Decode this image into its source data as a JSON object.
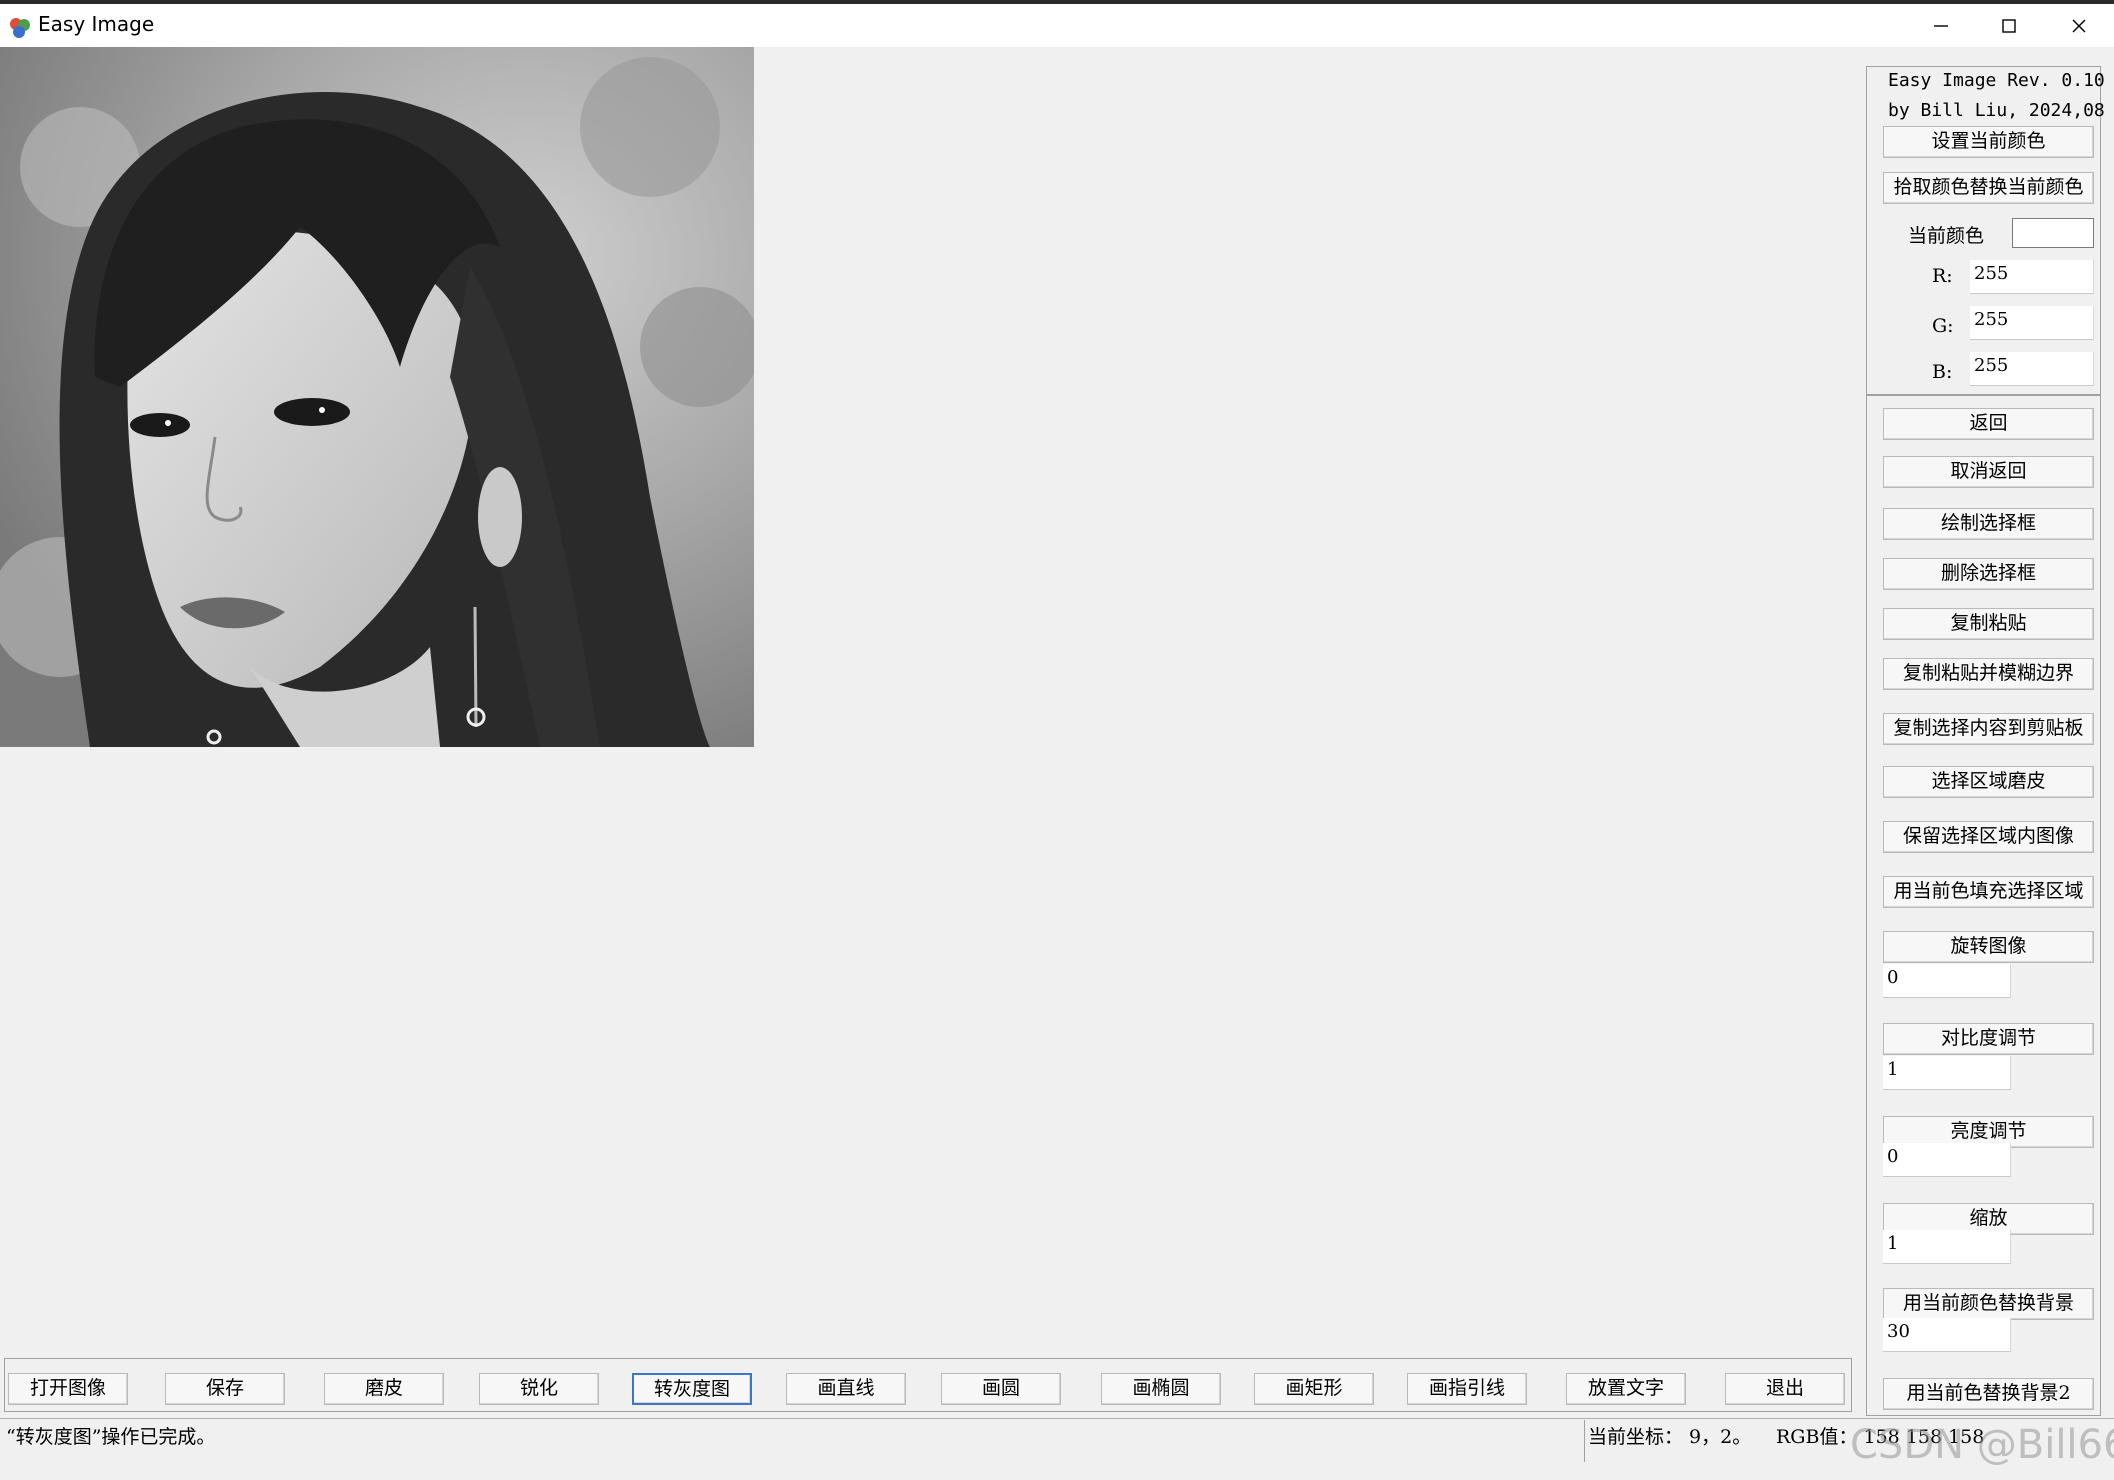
{
  "window": {
    "title": "Easy Image",
    "app_icon": "easy-image-app-icon",
    "controls": [
      "minimize-icon",
      "maximize-icon",
      "close-icon"
    ]
  },
  "panel": {
    "info_line1": "Easy Image Rev. 0.10",
    "info_line2": "by Bill Liu, 2024,08",
    "set_color_button": "设置当前颜色",
    "pick_color_button": "拾取颜色替换当前颜色",
    "current_color_label": "当前颜色",
    "current_color_value": "#ffffff",
    "r_label": "R:",
    "r_value": "255",
    "g_label": "G:",
    "g_value": "255",
    "b_label": "B:",
    "b_value": "255",
    "undo_button": "返回",
    "redo_button": "取消返回",
    "draw_selection_button": "绘制选择框",
    "delete_selection_button": "删除选择框",
    "copy_paste_button": "复制粘贴",
    "copy_paste_blur_button": "复制粘贴并模糊边界",
    "copy_to_clipboard_button": "复制选择内容到剪贴板",
    "selection_smooth_button": "选择区域磨皮",
    "keep_selection_button": "保留选择区域内图像",
    "fill_selection_button": "用当前色填充选择区域",
    "rotate_button": "旋转图像",
    "rotate_value": "0",
    "contrast_button": "对比度调节",
    "contrast_value": "1",
    "brightness_button": "亮度调节",
    "brightness_value": "0",
    "zoom_button": "缩放",
    "zoom_value": "1",
    "replace_bg_button": "用当前颜色替换背景",
    "replace_bg_value": "30",
    "replace_bg2_button": "用当前色替换背景2"
  },
  "toolbar": {
    "open": "打开图像",
    "save": "保存",
    "smooth": "磨皮",
    "sharpen": "锐化",
    "grayscale": "转灰度图",
    "line": "画直线",
    "circle": "画圆",
    "ellipse": "画椭圆",
    "rectangle": "画矩形",
    "leader": "画指引线",
    "text": "放置文字",
    "exit": "退出",
    "active": "grayscale"
  },
  "status": {
    "message": "“转灰度图”操作已完成。",
    "coord": "当前坐标：  9，2。",
    "rgb": "RGB值：  158  158  158"
  },
  "watermark": "CSDN @Bill66"
}
